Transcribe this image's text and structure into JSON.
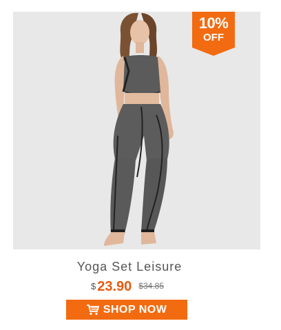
{
  "badge": {
    "percent": "10%",
    "off": "OFF",
    "color": "#f26b11"
  },
  "product": {
    "title": "Yoga Set Leisure",
    "currency": "$",
    "price": "23.90",
    "original_price": "$34.85",
    "image_icon": "product-photo"
  },
  "cta": {
    "label": "SHOP NOW",
    "icon": "cart-icon",
    "color": "#f26b11"
  },
  "colors": {
    "accent": "#f26b11",
    "price": "#e8590c",
    "text": "#555555"
  }
}
